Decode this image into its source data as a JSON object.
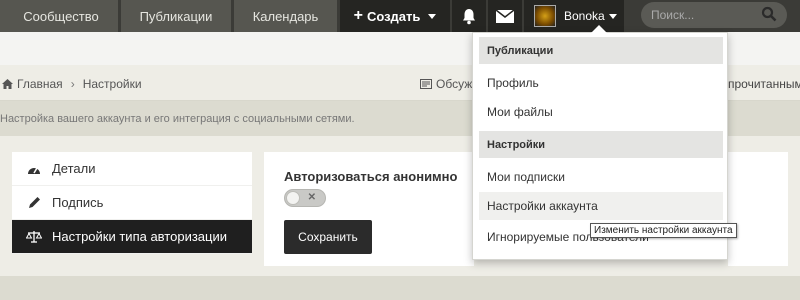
{
  "nav": {
    "tabs": [
      {
        "label": "Сообщество"
      },
      {
        "label": "Публикации"
      },
      {
        "label": "Календарь"
      }
    ],
    "create_label": "Создать",
    "username": "Bonoka",
    "search_placeholder": "Поиск..."
  },
  "breadcrumb": {
    "home": "Главная",
    "current": "Настройки"
  },
  "toolbar": {
    "discuss": "Обсужд",
    "read_all": "прочитанным"
  },
  "page": {
    "subtitle": "Настройка вашего аккаунта и его интеграция с социальными сетями."
  },
  "sidebar": {
    "items": [
      {
        "label": "Детали",
        "icon": "dashboard-icon"
      },
      {
        "label": "Подпись",
        "icon": "pencil-icon"
      },
      {
        "label": "Настройки типа авторизации",
        "icon": "scales-icon",
        "active": true
      }
    ]
  },
  "panel": {
    "title": "Авторизоваться анонимно",
    "toggle_state": "off",
    "save_label": "Сохранить"
  },
  "dropdown": {
    "header_publications": "Публикации",
    "profile": "Профиль",
    "my_files": "Мои файлы",
    "header_settings": "Настройки",
    "my_subscriptions": "Мои подписки",
    "account_settings": "Настройки аккаунта",
    "ignored_users": "Игнорируемые пользователи"
  },
  "tooltip": {
    "text": "Изменить настройки аккаунта"
  },
  "colors": {
    "nav_bg": "#3b3b37",
    "nav_tab": "#565650",
    "nav_dark": "#252522",
    "page_bg": "#dcdbd0",
    "active_item": "#1f1f1f"
  }
}
